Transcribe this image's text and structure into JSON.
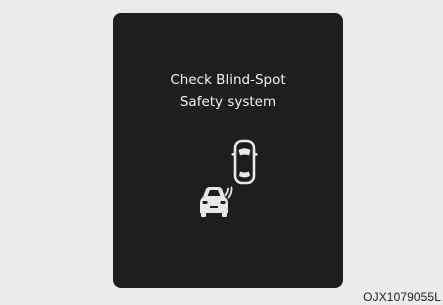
{
  "warning": {
    "line1": "Check Blind-Spot",
    "line2": "Safety system",
    "icon": "blind-spot-vehicles-icon"
  },
  "caption": "OJX1079055L",
  "colors": {
    "panel": "#1e1e1e",
    "text": "#f2f2f2",
    "background": "#ececec"
  }
}
